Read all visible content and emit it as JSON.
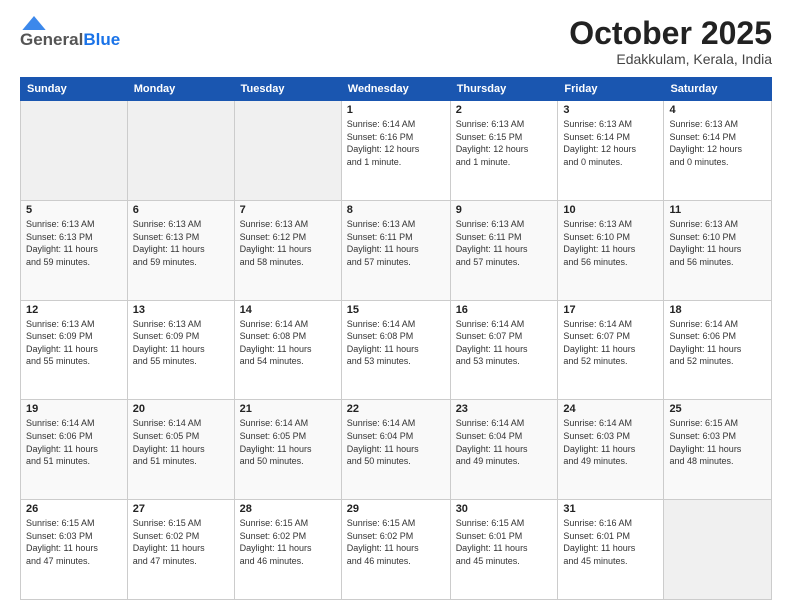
{
  "header": {
    "logo_general": "General",
    "logo_blue": "Blue",
    "month": "October 2025",
    "location": "Edakkulam, Kerala, India"
  },
  "days_of_week": [
    "Sunday",
    "Monday",
    "Tuesday",
    "Wednesday",
    "Thursday",
    "Friday",
    "Saturday"
  ],
  "weeks": [
    [
      {
        "day": "",
        "info": ""
      },
      {
        "day": "",
        "info": ""
      },
      {
        "day": "",
        "info": ""
      },
      {
        "day": "1",
        "info": "Sunrise: 6:14 AM\nSunset: 6:16 PM\nDaylight: 12 hours\nand 1 minute."
      },
      {
        "day": "2",
        "info": "Sunrise: 6:13 AM\nSunset: 6:15 PM\nDaylight: 12 hours\nand 1 minute."
      },
      {
        "day": "3",
        "info": "Sunrise: 6:13 AM\nSunset: 6:14 PM\nDaylight: 12 hours\nand 0 minutes."
      },
      {
        "day": "4",
        "info": "Sunrise: 6:13 AM\nSunset: 6:14 PM\nDaylight: 12 hours\nand 0 minutes."
      }
    ],
    [
      {
        "day": "5",
        "info": "Sunrise: 6:13 AM\nSunset: 6:13 PM\nDaylight: 11 hours\nand 59 minutes."
      },
      {
        "day": "6",
        "info": "Sunrise: 6:13 AM\nSunset: 6:13 PM\nDaylight: 11 hours\nand 59 minutes."
      },
      {
        "day": "7",
        "info": "Sunrise: 6:13 AM\nSunset: 6:12 PM\nDaylight: 11 hours\nand 58 minutes."
      },
      {
        "day": "8",
        "info": "Sunrise: 6:13 AM\nSunset: 6:11 PM\nDaylight: 11 hours\nand 57 minutes."
      },
      {
        "day": "9",
        "info": "Sunrise: 6:13 AM\nSunset: 6:11 PM\nDaylight: 11 hours\nand 57 minutes."
      },
      {
        "day": "10",
        "info": "Sunrise: 6:13 AM\nSunset: 6:10 PM\nDaylight: 11 hours\nand 56 minutes."
      },
      {
        "day": "11",
        "info": "Sunrise: 6:13 AM\nSunset: 6:10 PM\nDaylight: 11 hours\nand 56 minutes."
      }
    ],
    [
      {
        "day": "12",
        "info": "Sunrise: 6:13 AM\nSunset: 6:09 PM\nDaylight: 11 hours\nand 55 minutes."
      },
      {
        "day": "13",
        "info": "Sunrise: 6:13 AM\nSunset: 6:09 PM\nDaylight: 11 hours\nand 55 minutes."
      },
      {
        "day": "14",
        "info": "Sunrise: 6:14 AM\nSunset: 6:08 PM\nDaylight: 11 hours\nand 54 minutes."
      },
      {
        "day": "15",
        "info": "Sunrise: 6:14 AM\nSunset: 6:08 PM\nDaylight: 11 hours\nand 53 minutes."
      },
      {
        "day": "16",
        "info": "Sunrise: 6:14 AM\nSunset: 6:07 PM\nDaylight: 11 hours\nand 53 minutes."
      },
      {
        "day": "17",
        "info": "Sunrise: 6:14 AM\nSunset: 6:07 PM\nDaylight: 11 hours\nand 52 minutes."
      },
      {
        "day": "18",
        "info": "Sunrise: 6:14 AM\nSunset: 6:06 PM\nDaylight: 11 hours\nand 52 minutes."
      }
    ],
    [
      {
        "day": "19",
        "info": "Sunrise: 6:14 AM\nSunset: 6:06 PM\nDaylight: 11 hours\nand 51 minutes."
      },
      {
        "day": "20",
        "info": "Sunrise: 6:14 AM\nSunset: 6:05 PM\nDaylight: 11 hours\nand 51 minutes."
      },
      {
        "day": "21",
        "info": "Sunrise: 6:14 AM\nSunset: 6:05 PM\nDaylight: 11 hours\nand 50 minutes."
      },
      {
        "day": "22",
        "info": "Sunrise: 6:14 AM\nSunset: 6:04 PM\nDaylight: 11 hours\nand 50 minutes."
      },
      {
        "day": "23",
        "info": "Sunrise: 6:14 AM\nSunset: 6:04 PM\nDaylight: 11 hours\nand 49 minutes."
      },
      {
        "day": "24",
        "info": "Sunrise: 6:14 AM\nSunset: 6:03 PM\nDaylight: 11 hours\nand 49 minutes."
      },
      {
        "day": "25",
        "info": "Sunrise: 6:15 AM\nSunset: 6:03 PM\nDaylight: 11 hours\nand 48 minutes."
      }
    ],
    [
      {
        "day": "26",
        "info": "Sunrise: 6:15 AM\nSunset: 6:03 PM\nDaylight: 11 hours\nand 47 minutes."
      },
      {
        "day": "27",
        "info": "Sunrise: 6:15 AM\nSunset: 6:02 PM\nDaylight: 11 hours\nand 47 minutes."
      },
      {
        "day": "28",
        "info": "Sunrise: 6:15 AM\nSunset: 6:02 PM\nDaylight: 11 hours\nand 46 minutes."
      },
      {
        "day": "29",
        "info": "Sunrise: 6:15 AM\nSunset: 6:02 PM\nDaylight: 11 hours\nand 46 minutes."
      },
      {
        "day": "30",
        "info": "Sunrise: 6:15 AM\nSunset: 6:01 PM\nDaylight: 11 hours\nand 45 minutes."
      },
      {
        "day": "31",
        "info": "Sunrise: 6:16 AM\nSunset: 6:01 PM\nDaylight: 11 hours\nand 45 minutes."
      },
      {
        "day": "",
        "info": ""
      }
    ]
  ]
}
